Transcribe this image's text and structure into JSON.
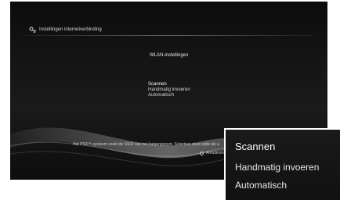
{
  "header": {
    "title": "Instellingen internetverbinding",
    "icon": "network-settings-icon"
  },
  "page": {
    "section_title": "WLAN-instellingen"
  },
  "menu": {
    "items": [
      {
        "label": "Scannen",
        "selected": true
      },
      {
        "label": "Handmatig invoeren",
        "selected": false
      },
      {
        "label": "Automatisch",
        "selected": false
      }
    ]
  },
  "footer": {
    "hint_text": "Het PS3™-systeem zoekt de SSID van het toegangspunt. Selecteer deze optie als u",
    "cancel_label": "Annuleren"
  },
  "zoom_inset": {
    "items": [
      {
        "label": "Scannen",
        "selected": true
      },
      {
        "label": "Handmatig invoeren",
        "selected": false
      },
      {
        "label": "Automatisch",
        "selected": false
      }
    ]
  }
}
